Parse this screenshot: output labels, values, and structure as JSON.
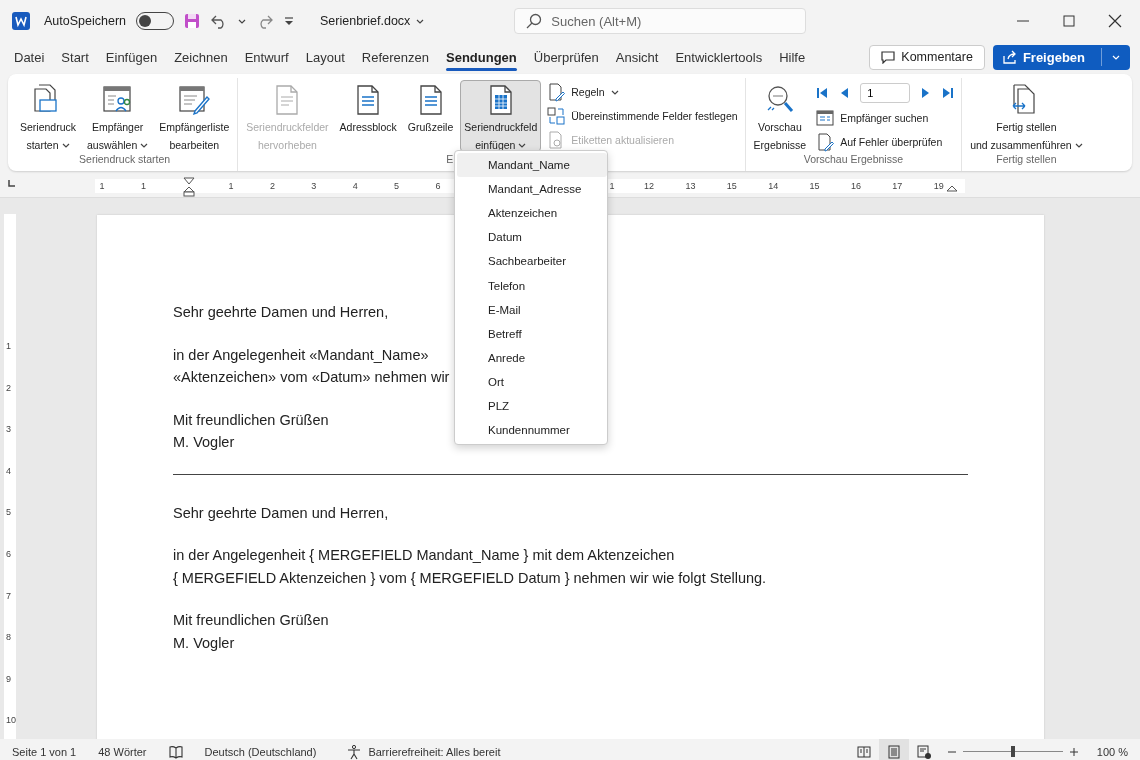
{
  "title_bar": {
    "autosave": {
      "label": "AutoSpeichern",
      "on": false
    },
    "file_name": "Serienbrief.docx",
    "search": {
      "placeholder": "Suchen (Alt+M)"
    }
  },
  "tabs": [
    {
      "label": "Datei",
      "selected": false
    },
    {
      "label": "Start",
      "selected": false
    },
    {
      "label": "Einfügen",
      "selected": false
    },
    {
      "label": "Zeichnen",
      "selected": false
    },
    {
      "label": "Entwurf",
      "selected": false
    },
    {
      "label": "Layout",
      "selected": false
    },
    {
      "label": "Referenzen",
      "selected": false
    },
    {
      "label": "Sendungen",
      "selected": true
    },
    {
      "label": "Überprüfen",
      "selected": false
    },
    {
      "label": "Ansicht",
      "selected": false
    },
    {
      "label": "Entwicklertools",
      "selected": false
    },
    {
      "label": "Hilfe",
      "selected": false
    }
  ],
  "comments_button": "Kommentare",
  "share_button": "Freigeben",
  "ribbon": [
    {
      "label": "Seriendruck starten",
      "items": [
        {
          "kind": "large",
          "lines": [
            "Seriendruck",
            "starten"
          ],
          "dropdown": true,
          "disabled": false,
          "selected": false
        },
        {
          "kind": "large",
          "lines": [
            "Empfänger",
            "auswählen"
          ],
          "dropdown": true,
          "disabled": false,
          "selected": false
        },
        {
          "kind": "large",
          "lines": [
            "Empfängerliste",
            "bearbeiten"
          ],
          "dropdown": false,
          "disabled": false,
          "selected": false
        }
      ]
    },
    {
      "label": "E",
      "items": [
        {
          "kind": "large",
          "lines": [
            "Seriendruckfelder",
            "hervorheben"
          ],
          "dropdown": false,
          "disabled": true,
          "selected": false
        },
        {
          "kind": "large",
          "lines": [
            "Adressblock"
          ],
          "dropdown": false,
          "disabled": false,
          "selected": false
        },
        {
          "kind": "large",
          "lines": [
            "Grußzeile"
          ],
          "dropdown": false,
          "disabled": false,
          "selected": false
        },
        {
          "kind": "large",
          "lines": [
            "Seriendruckfeld",
            "einfügen"
          ],
          "dropdown": true,
          "disabled": false,
          "selected": true
        },
        {
          "kind": "small",
          "label": "Regeln",
          "dropdown": true,
          "disabled": false
        },
        {
          "kind": "small",
          "label": "Übereinstimmende Felder festlegen",
          "dropdown": false,
          "disabled": false
        },
        {
          "kind": "small",
          "label": "Etiketten aktualisieren",
          "dropdown": false,
          "disabled": true
        }
      ]
    },
    {
      "label": "Vorschau Ergebnisse",
      "items": [
        {
          "kind": "large",
          "lines": [
            "Vorschau",
            "Ergebnisse"
          ],
          "dropdown": false,
          "disabled": false,
          "selected": false
        },
        {
          "kind": "nav",
          "value": "1"
        },
        {
          "kind": "small",
          "label": "Empfänger suchen",
          "dropdown": false,
          "disabled": false
        },
        {
          "kind": "small",
          "label": "Auf Fehler überprüfen",
          "dropdown": false,
          "disabled": false
        }
      ]
    },
    {
      "label": "Fertig stellen",
      "items": [
        {
          "kind": "large",
          "lines": [
            "Fertig stellen",
            "und zusammenführen"
          ],
          "dropdown": true,
          "disabled": false,
          "selected": false
        }
      ]
    }
  ],
  "ruler": {
    "left_labels": [
      "1",
      "1"
    ],
    "labels": [
      "1",
      "2",
      "3",
      "4",
      "5",
      "6"
    ],
    "right_labels": [
      "1",
      "12",
      "13",
      "15",
      "14",
      "15",
      "16",
      "17",
      "19"
    ]
  },
  "vertical_ruler": {
    "labels": [
      "1",
      "2",
      "3",
      "4",
      "5",
      "6",
      "7",
      "8",
      "9",
      "10"
    ]
  },
  "document": {
    "blocks": [
      {
        "kind": "para",
        "lines": [
          "Sehr geehrte Damen und Herren,"
        ]
      },
      {
        "kind": "para",
        "lines": [
          "in der Angelegenheit «Mandant_Name»",
          "«Aktenzeichen» vom «Datum» nehmen wir"
        ]
      },
      {
        "kind": "para",
        "lines": [
          "Mit freundlichen Grüßen",
          "M. Vogler"
        ]
      },
      {
        "kind": "rule"
      },
      {
        "kind": "para",
        "lines": [
          "Sehr geehrte Damen und Herren,"
        ]
      },
      {
        "kind": "para",
        "lines": [
          "in der Angelegenheit { MERGEFIELD Mandant_Name } mit dem Aktenzeichen",
          "{ MERGEFIELD Aktenzeichen } vom { MERGEFIELD Datum } nehmen wir wie folgt Stellung."
        ]
      },
      {
        "kind": "para",
        "lines": [
          "Mit freundlichen Grüßen",
          "M. Vogler"
        ]
      }
    ]
  },
  "field_menu": [
    {
      "label": "Mandant_Name",
      "selected": true
    },
    {
      "label": "Mandant_Adresse",
      "selected": false
    },
    {
      "label": "Aktenzeichen",
      "selected": false
    },
    {
      "label": "Datum",
      "selected": false
    },
    {
      "label": "Sachbearbeiter",
      "selected": false
    },
    {
      "label": "Telefon",
      "selected": false
    },
    {
      "label": "E-Mail",
      "selected": false
    },
    {
      "label": "Betreff",
      "selected": false
    },
    {
      "label": "Anrede",
      "selected": false
    },
    {
      "label": "Ort",
      "selected": false
    },
    {
      "label": "PLZ",
      "selected": false
    },
    {
      "label": "Kundennummer",
      "selected": false
    }
  ],
  "status_bar": {
    "page": "Seite 1 von 1",
    "words": "48 Wörter",
    "language": "Deutsch (Deutschland)",
    "accessibility": "Barrierefreiheit: Alles bereit",
    "views": [
      {
        "selected": false
      },
      {
        "selected": true
      },
      {
        "selected": false
      }
    ],
    "zoom": {
      "level": 0.5,
      "reading": "100 %"
    }
  }
}
